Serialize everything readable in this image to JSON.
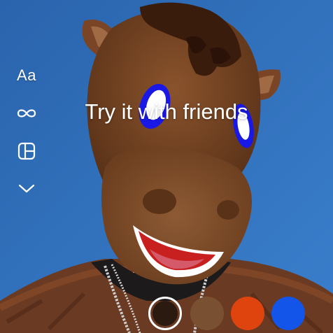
{
  "caption": {
    "text": "Try it with friends"
  },
  "tools": {
    "text_label": "Aa",
    "icons": [
      "text-tool-icon",
      "infinity-loop-icon",
      "layout-grid-icon",
      "chevron-down-icon"
    ]
  },
  "colors": {
    "background_blue": "#2f6fb8",
    "swatches": [
      "#2b1a10",
      "#7a5032",
      "#e0440e",
      "#1255e8"
    ],
    "selected_index": 0
  }
}
